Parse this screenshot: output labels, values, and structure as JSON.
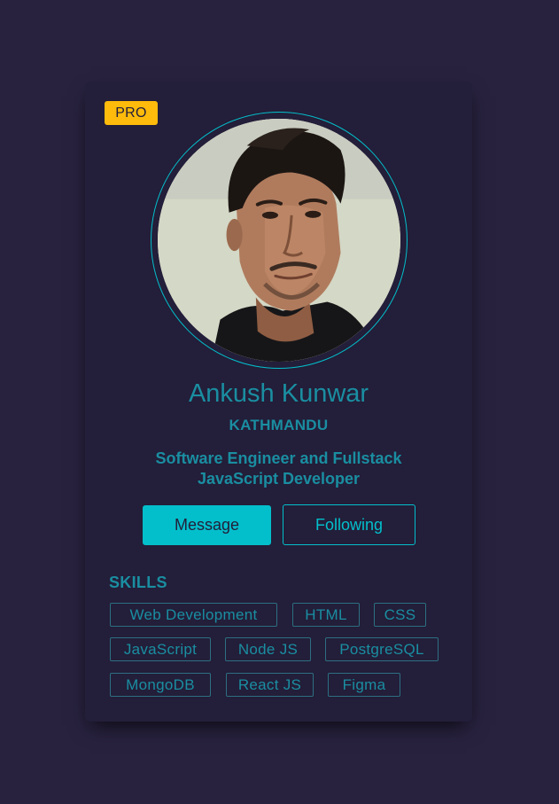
{
  "badge": {
    "label": "PRO"
  },
  "profile": {
    "name": "Ankush Kunwar",
    "location": "KATHMANDU",
    "bio_line1": "Software Engineer and Fullstack",
    "bio_line2": "JavaScript Developer"
  },
  "actions": {
    "message_label": "Message",
    "following_label": "Following"
  },
  "skills": {
    "title": "SKILLS",
    "items": [
      "Web Development",
      "HTML",
      "CSS",
      "JavaScript",
      "Node JS",
      "PostgreSQL",
      "MongoDB",
      "React JS",
      "Figma"
    ]
  },
  "colors": {
    "page_bg": "#28223f",
    "card_bg": "#231e39",
    "accent": "#03bfcb",
    "text": "#1a8ea1",
    "badge": "#febb0b"
  }
}
